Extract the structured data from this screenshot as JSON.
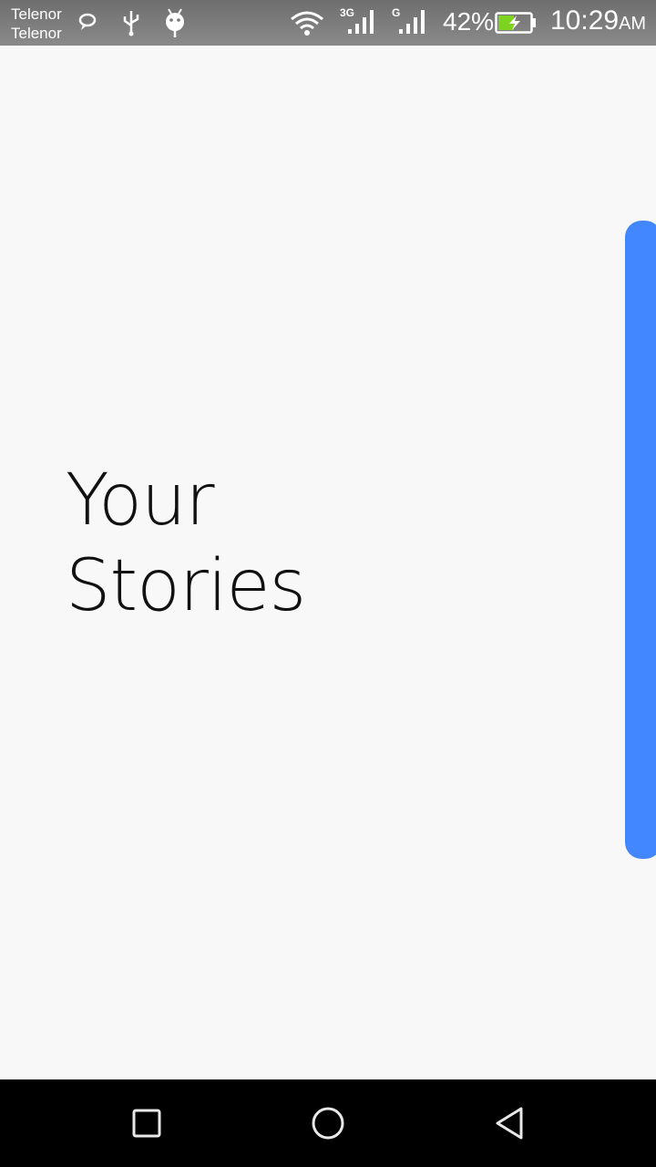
{
  "status_bar": {
    "carrier_1": "Telenor",
    "carrier_2": "Telenor",
    "icons": [
      "chat-icon",
      "usb-icon",
      "android-icon",
      "wifi-icon",
      "signal-3g-icon",
      "signal-g-icon",
      "battery-charging-icon"
    ],
    "network_1": "3G",
    "network_2": "G",
    "battery_percent": "42%",
    "time": "10:29",
    "ampm": "AM"
  },
  "main": {
    "title_line_1": "Your",
    "title_line_2": "Stories"
  },
  "colors": {
    "accent": "#4287ff",
    "background": "#f8f8f8",
    "battery_fill": "#7ed321"
  },
  "nav_bar": {
    "icons": [
      "recent-apps-icon",
      "home-icon",
      "back-icon"
    ]
  }
}
